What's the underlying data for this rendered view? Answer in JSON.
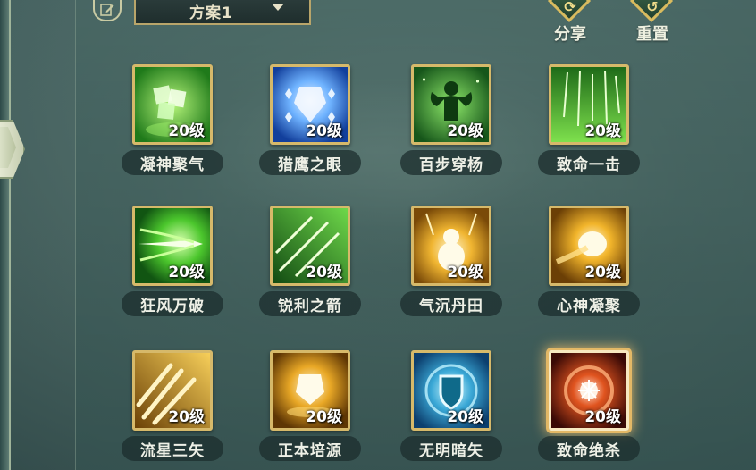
{
  "header": {
    "plan_label": "方案1",
    "share_label": "分享",
    "reset_label": "重置"
  },
  "skills": [
    {
      "name": "凝神聚气",
      "level": "20级"
    },
    {
      "name": "猎鹰之眼",
      "level": "20级"
    },
    {
      "name": "百步穿杨",
      "level": "20级"
    },
    {
      "name": "致命一击",
      "level": "20级"
    },
    {
      "name": "狂风万破",
      "level": "20级"
    },
    {
      "name": "锐利之箭",
      "level": "20级"
    },
    {
      "name": "气沉丹田",
      "level": "20级"
    },
    {
      "name": "心神凝聚",
      "level": "20级"
    },
    {
      "name": "流星三矢",
      "level": "20级"
    },
    {
      "name": "正本培源",
      "level": "20级"
    },
    {
      "name": "无明暗矢",
      "level": "20级"
    },
    {
      "name": "致命绝杀",
      "level": "20级"
    }
  ],
  "colors": {
    "frame_gold": "#d6b96a",
    "selected_glow": "#e3b866",
    "green_skill": "#3fbf2e",
    "gold_skill": "#d9a019",
    "blue_skill": "#2a7fd6",
    "red_skill": "#c0391e"
  }
}
